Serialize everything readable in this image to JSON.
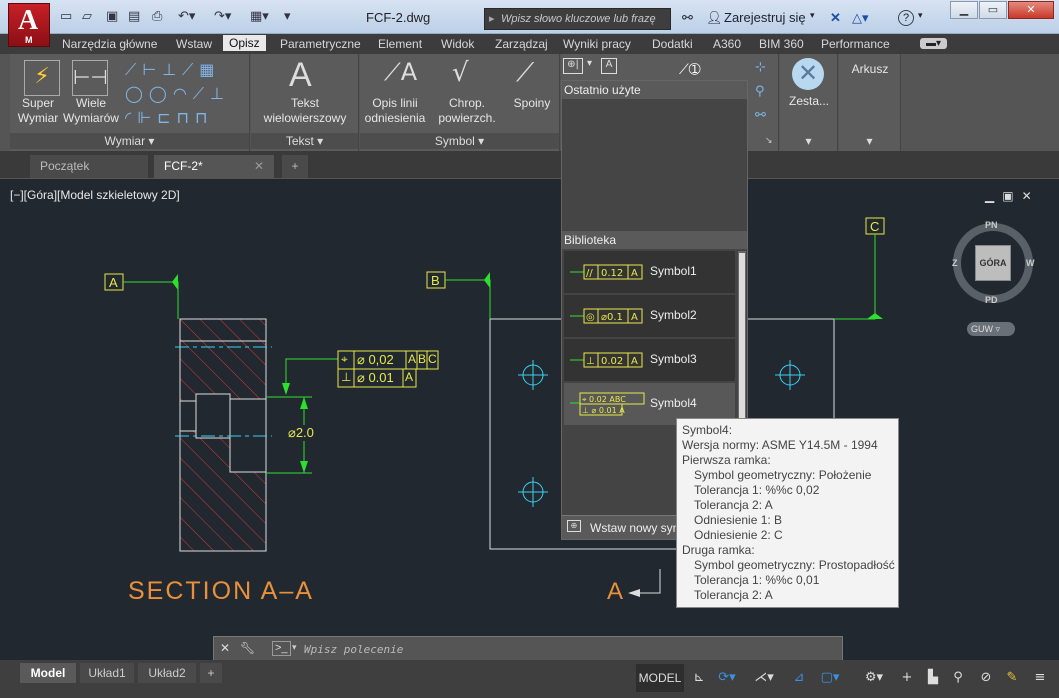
{
  "app": {
    "title": "FCF-2.dwg",
    "logo_letter": "A",
    "logo_sub": "M"
  },
  "search": {
    "placeholder": "Wpisz słowo kluczowe lub frazę"
  },
  "titlebar": {
    "signin": "Zarejestruj się",
    "help": "?"
  },
  "menu_tabs": [
    "Narzędzia główne",
    "Wstaw",
    "Opisz",
    "Parametryczne",
    "Element",
    "Widok",
    "Zarządzaj",
    "Wyniki pracy",
    "Dodatki",
    "A360",
    "BIM 360",
    "Performance"
  ],
  "menu_active": "Opisz",
  "ribbon": {
    "wymiar": {
      "super": "Super\nWymiar",
      "wiele": "Wiele\nWymiarów",
      "title": "Wymiar"
    },
    "tekst": {
      "label": "Tekst\nwielowierszowy",
      "title": "Tekst"
    },
    "symbol": {
      "opis": "Opis linii\nodniesienia",
      "chrop": "Chrop.\npowierzch.",
      "spoiny": "Spoiny",
      "title": "Symbol"
    },
    "zesta": "Zesta...",
    "arkusz": "Arkusz"
  },
  "doc_tabs": {
    "start": "Początek",
    "current": "FCF-2*"
  },
  "viewport": {
    "label": "[−][Góra][Model szkieletowy 2D]"
  },
  "viewcube": {
    "top": "GÓRA",
    "n": "PN",
    "s": "PD",
    "e": "W",
    "w": "Z",
    "wcs": "GUW"
  },
  "drawing": {
    "section_title": "SECTION A–A",
    "datum_a": "A",
    "datum_b": "B",
    "datum_c": "C",
    "cut_label": "A",
    "dim": "⌀2.0",
    "fcf1": {
      "sym": "⌖",
      "tol": "⌀ 0,02",
      "d1": "A",
      "d2": "B",
      "d3": "C"
    },
    "fcf2": {
      "sym": "⊥",
      "tol": "⌀ 0.01",
      "d1": "A"
    }
  },
  "dropdown": {
    "recent": "Ostatnio użyte",
    "library": "Biblioteka",
    "symbols": [
      {
        "name": "Symbol1",
        "frame": "//|0.12|A"
      },
      {
        "name": "Symbol2",
        "frame": "◎|⌀0.1|A"
      },
      {
        "name": "Symbol3",
        "frame": "⊥|0.02|A"
      },
      {
        "name": "Symbol4",
        "frame": "⌖|0.02|ABC"
      }
    ],
    "insert": "Wstaw nowy sym"
  },
  "tooltip": {
    "title": "Symbol4:",
    "standard": "Wersja normy: ASME Y14.5M - 1994",
    "frame1": "Pierwsza ramka:",
    "f1_sym": "Symbol geometryczny: Położenie",
    "f1_t1": "Tolerancja 1: %%c 0,02",
    "f1_t2": "Tolerancja 2: A",
    "f1_r1": "Odniesienie 1: B",
    "f1_r2": "Odniesienie 2: C",
    "frame2": "Druga ramka:",
    "f2_sym": "Symbol geometryczny: Prostopadłość",
    "f2_t1": "Tolerancja 1: %%c 0,01",
    "f2_t2": "Tolerancja 2: A"
  },
  "cmd": {
    "placeholder": "Wpisz polecenie"
  },
  "layout_tabs": [
    "Model",
    "Układ1",
    "Układ2"
  ],
  "status": {
    "model": "MODEL"
  }
}
